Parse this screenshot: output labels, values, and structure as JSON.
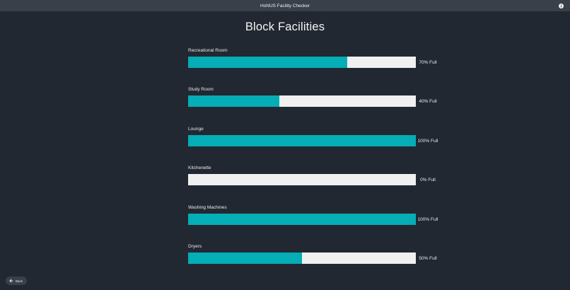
{
  "app": {
    "title": "HoNUS Facility Checker",
    "info_icon": "info-icon"
  },
  "page": {
    "title": "Block Facilities"
  },
  "colors": {
    "fill": "#05adb6",
    "track": "#f0f0f0",
    "background": "#222831",
    "titlebar": "#39404a"
  },
  "facilities": [
    {
      "name": "Recreational Room",
      "level_percent": 70,
      "label": "70% Full"
    },
    {
      "name": "Study Room",
      "level_percent": 40,
      "label": "40% Full"
    },
    {
      "name": "Lounge",
      "level_percent": 100,
      "label": "100% Full"
    },
    {
      "name": "Kitchenette",
      "level_percent": 0,
      "label": "0% Full"
    },
    {
      "name": "Washing Machines",
      "level_percent": 100,
      "label": "100% Full"
    },
    {
      "name": "Dryers",
      "level_percent": 50,
      "label": "50% Full"
    }
  ],
  "footer": {
    "back_label": "Back",
    "back_icon": "arrow-left-icon"
  }
}
